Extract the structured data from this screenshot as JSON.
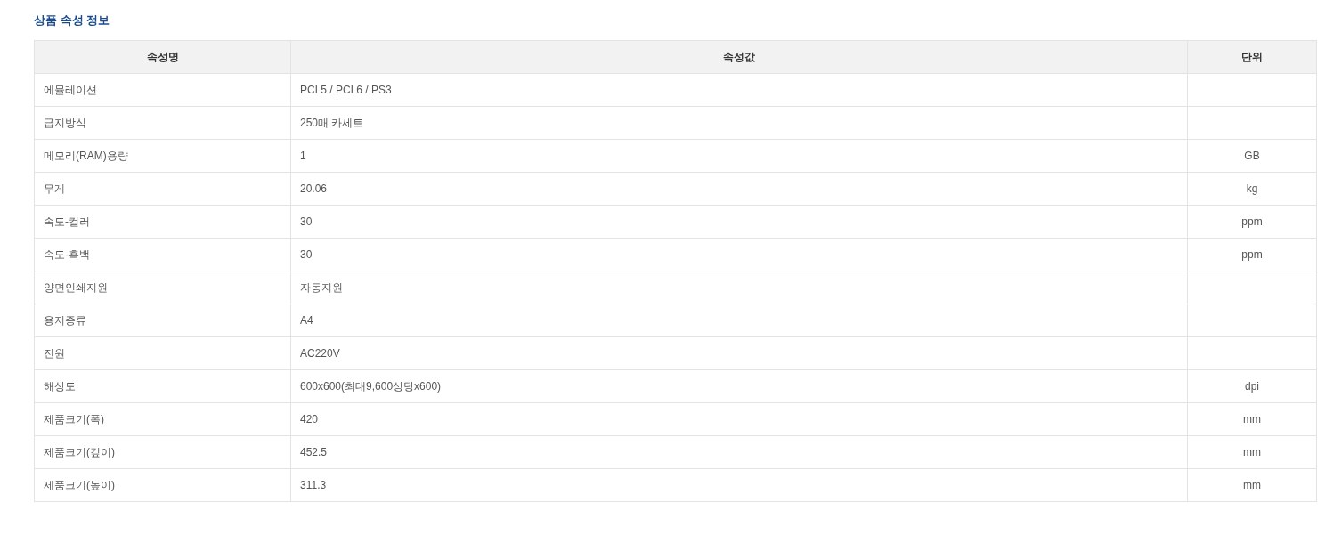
{
  "title": "상품 속성 정보",
  "table": {
    "columns": [
      "속성명",
      "속성값",
      "단위"
    ],
    "rows": [
      {
        "name": "에뮬레이션",
        "value": "PCL5 / PCL6 / PS3"
      },
      {
        "name": "급지방식",
        "value": "250매 카세트"
      },
      {
        "name": "메모리(RAM)용량",
        "value": "1",
        "unit": "GB"
      },
      {
        "name": "무게",
        "value": "20.06",
        "unit": "kg"
      },
      {
        "name": "속도-컬러",
        "value": "30",
        "unit": "ppm"
      },
      {
        "name": "속도-흑백",
        "value": "30",
        "unit": "ppm"
      },
      {
        "name": "양면인쇄지원",
        "value": "자동지원"
      },
      {
        "name": "용지종류",
        "value": "A4"
      },
      {
        "name": "전원",
        "value": "AC220V"
      },
      {
        "name": "해상도",
        "value": "600x600(최대9,600상당x600)",
        "unit": "dpi"
      },
      {
        "name": "제품크기(폭)",
        "value": "420",
        "unit": "mm"
      },
      {
        "name": "제품크기(깊이)",
        "value": "452.5",
        "unit": "mm"
      },
      {
        "name": "제품크기(높이)",
        "value": "311.3",
        "unit": "mm"
      }
    ]
  }
}
